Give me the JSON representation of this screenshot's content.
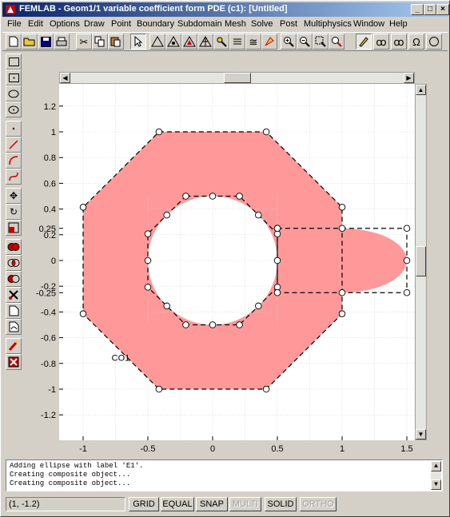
{
  "window": {
    "title": "FEMLAB - Geom1/1 variable coefficient form PDE (c1): [Untitled]"
  },
  "title_buttons": {
    "minimize": "_",
    "maximize": "□",
    "close": "×"
  },
  "menu": [
    "File",
    "Edit",
    "Options",
    "Draw",
    "Point",
    "Boundary",
    "Subdomain",
    "Mesh",
    "Solve",
    "Post",
    "Multiphysics",
    "Window",
    "Help"
  ],
  "plot": {
    "x_ticks": [
      "-1",
      "-0.5",
      "0",
      "0.5",
      "1",
      "1.5"
    ],
    "y_ticks": [
      "1.2",
      "1",
      "0.8",
      "0.6",
      "0.4",
      "0.25",
      "0.2",
      "0",
      "-0.2",
      "-0.25",
      "-0.4",
      "-0.6",
      "-0.8",
      "-1",
      "-1.2"
    ],
    "object_label": "CO1",
    "fill_color": "#ff9999"
  },
  "messages": [
    "Adding ellipse with label 'E1'.",
    "Creating composite object...",
    "Creating composite object..."
  ],
  "status": {
    "coords": "(1, -1.2)",
    "buttons": [
      {
        "label": "GRID",
        "enabled": true
      },
      {
        "label": "EQUAL",
        "enabled": true
      },
      {
        "label": "SNAP",
        "enabled": true
      },
      {
        "label": "MULTI",
        "enabled": false
      },
      {
        "label": "SOLID",
        "enabled": true
      },
      {
        "label": "ORTHO",
        "enabled": false
      }
    ]
  }
}
